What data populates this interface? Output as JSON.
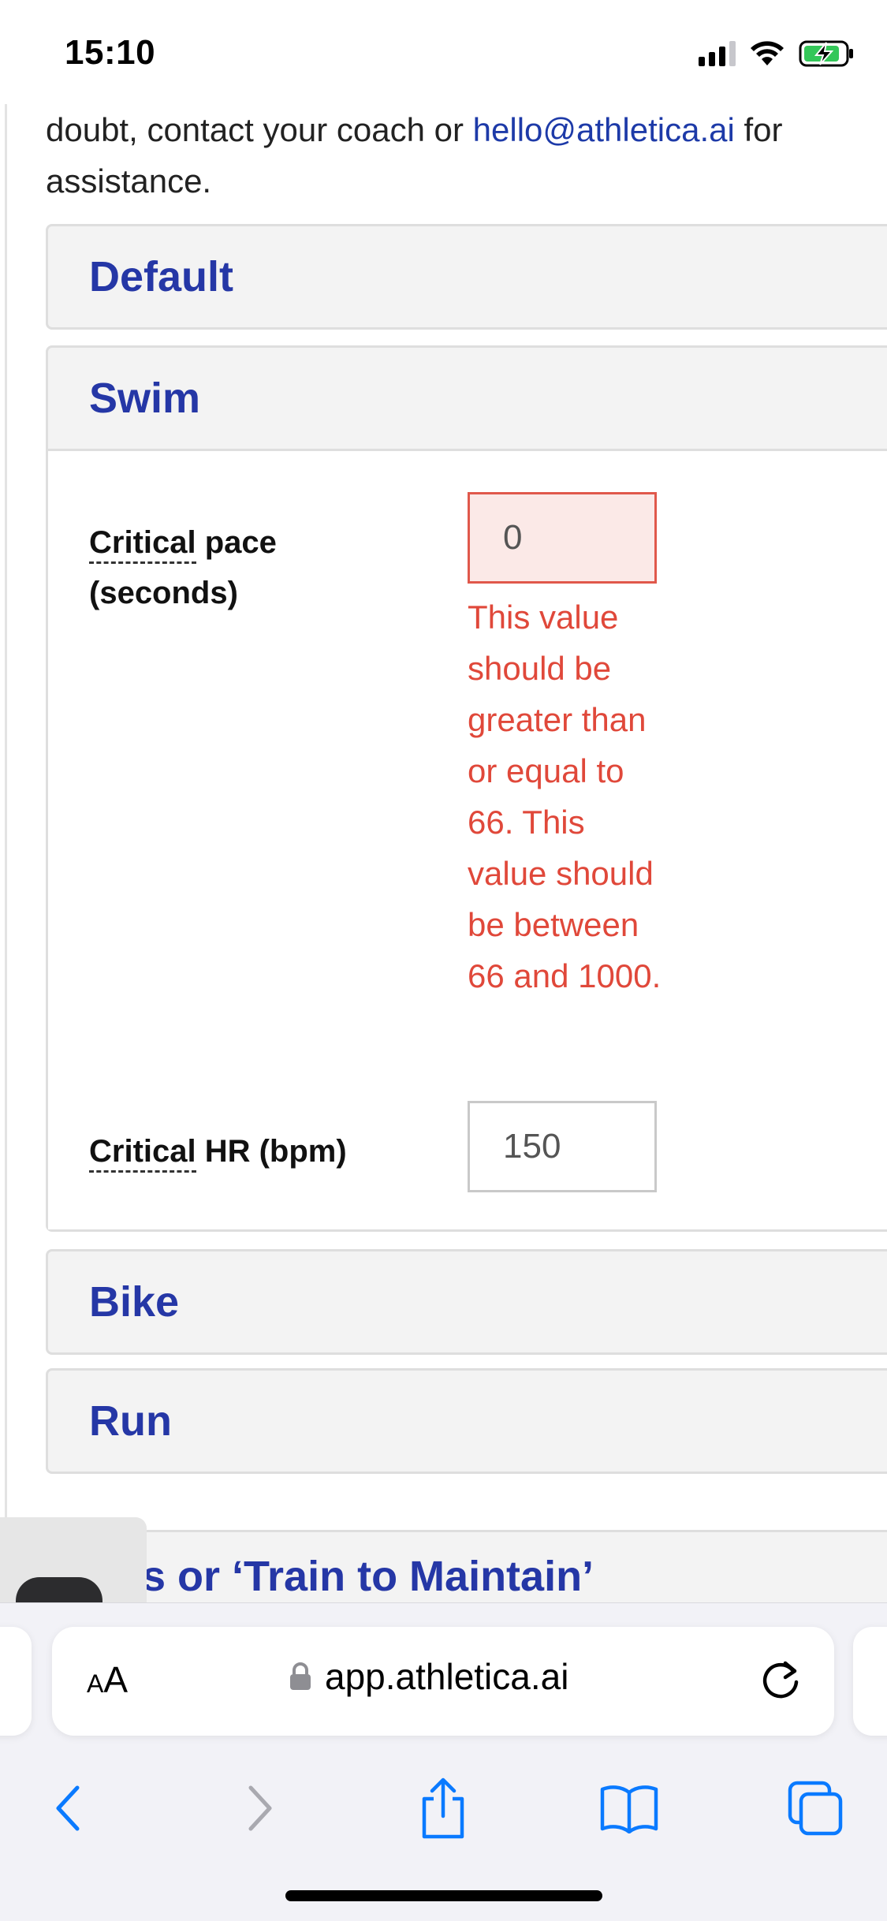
{
  "status_bar": {
    "time": "15:10"
  },
  "intro": {
    "text_before": "doubt, contact your coach or ",
    "email": "hello@athletica.ai",
    "text_after": " for assistance."
  },
  "panels": {
    "default": {
      "title": "Default"
    },
    "swim": {
      "title": "Swim",
      "critical_pace": {
        "label_abbr": "Critical",
        "label_rest": " pace (seconds)",
        "value": "0",
        "errors": "This value should be greater than or equal to 66. This value should be between 66 and 1000."
      },
      "critical_hr": {
        "label_abbr": "Critical",
        "label_rest": " HR (bpm)",
        "value": "150"
      }
    },
    "bike": {
      "title": "Bike"
    },
    "run": {
      "title": "Run"
    }
  },
  "partial_section": {
    "title": "s or ‘Train to Maintain’"
  },
  "browser": {
    "aa_label_small": "A",
    "aa_label_large": "A",
    "url": "app.athletica.ai"
  },
  "colors": {
    "accent": "#2537a6",
    "link": "#1d3aa8",
    "error": "#e0483a",
    "safari_blue": "#0a7aff"
  },
  "icons": [
    "signal-icon",
    "wifi-icon",
    "battery-charging-icon",
    "lock-icon",
    "reload-icon",
    "back-icon",
    "forward-icon",
    "share-icon",
    "bookmarks-icon",
    "tabs-icon"
  ]
}
